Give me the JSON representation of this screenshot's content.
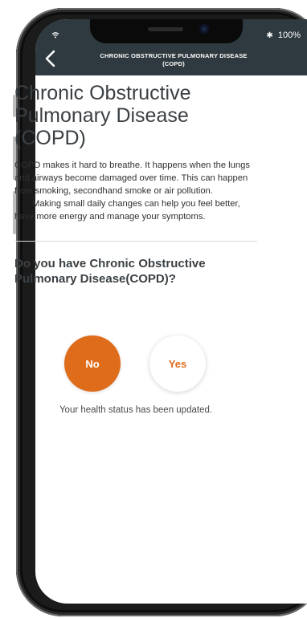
{
  "status_bar": {
    "battery_text": "100%",
    "bluetooth_glyph": "✱",
    "wifi_icon": "wifi-icon"
  },
  "header": {
    "title_line1": "CHRONIC OBSTRUCTIVE PULMONARY DISEASE",
    "title_line2": "(COPD)",
    "background": "#2e3a3f"
  },
  "main": {
    "title": "Chronic Obstructive Pulmonary Disease (COPD)",
    "paragraph1": "COPD makes it hard to breathe. It happens when the lungs and airways become damaged over time. This can happen from smoking, secondhand smoke or air pollution.",
    "paragraph2": "Making small daily changes can help you feel better, have more energy and manage your symptoms.",
    "question": "Do you have Chronic Obstructive Pulmonary Disease(COPD)?",
    "choices": {
      "no_label": "No",
      "yes_label": "Yes",
      "selected": "No"
    },
    "status_message": "Your health status has been updated."
  },
  "colors": {
    "accent": "#df6c1b",
    "text_dark": "#3b4044"
  }
}
